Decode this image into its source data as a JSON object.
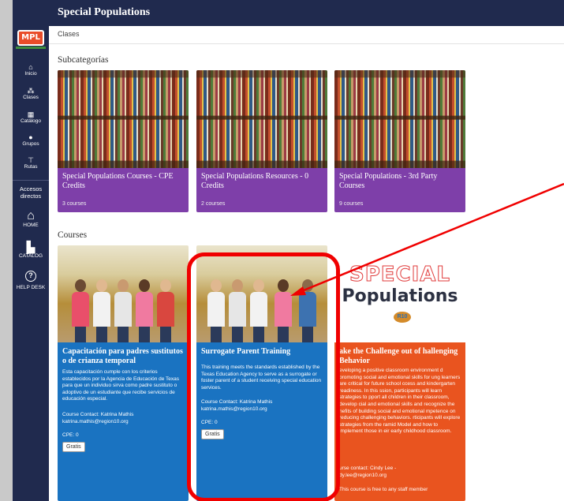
{
  "app": {
    "title": "Special Populations"
  },
  "tabs": {
    "active": "Clases"
  },
  "sidebar": {
    "logo": "MPL",
    "nav": [
      {
        "icon": "home-icon",
        "glyph": "⌂",
        "label": "Inicio"
      },
      {
        "icon": "classes-icon",
        "glyph": "⁂",
        "label": "Clases"
      },
      {
        "icon": "catalog-icon",
        "glyph": "▦",
        "label": "Catálogo"
      },
      {
        "icon": "groups-icon",
        "glyph": "●",
        "label": "Grupos"
      },
      {
        "icon": "routes-icon",
        "glyph": "⊤",
        "label": "Rutas"
      }
    ],
    "shortcuts_title": "Accesos directos",
    "shortcuts": [
      {
        "icon": "home-icon",
        "glyph": "⌂",
        "label": "HOME"
      },
      {
        "icon": "catalog-icon",
        "glyph": "▙",
        "label": "CATALOG"
      },
      {
        "icon": "help-desk-icon",
        "glyph": "?",
        "label": "HELP DESK"
      }
    ]
  },
  "subcategories": {
    "heading": "Subcategorías",
    "items": [
      {
        "title": "Special Populations Courses - CPE Credits",
        "count": "3 courses"
      },
      {
        "title": "Special Populations Resources - 0 Credits",
        "count": "2 courses"
      },
      {
        "title": "Special Populations - 3rd Party Courses",
        "count": "9 courses"
      }
    ]
  },
  "courses": {
    "heading": "Courses",
    "items": [
      {
        "title": "Capacitación para padres sustitutos o de crianza temporal",
        "description": "Esta capacitación cumple con los criterios establecidos por la Agencia de Educación de Texas para que un individuo sirva como padre sustituto o adoptivo de un estudiante que recibe servicios de educación especial.",
        "contact": "Course Contact: Katrina Mathis",
        "email": "katrina.mathis@region10.org",
        "cpe": "CPE: 0",
        "button": "Gratis",
        "color": "#1a73c1"
      },
      {
        "title": "Surrogate Parent Training",
        "description": "This training meets the standards established by the Texas Education Agency to serve as a surrogate or foster parent of a student receiving special education services.",
        "contact": "Course Contact: Katrina Mathis",
        "email": "katrina.mathis@region10.org",
        "cpe": "CPE: 0",
        "button": "Gratis",
        "color": "#1a73c1"
      },
      {
        "title": "ake the Challenge out of hallenging Behavior",
        "description": "eveloping a positive classroom environment d promoting social and emotional skills for ung learners are critical for future school ccess and kindergarten readiness. In this ssion, participants will learn strategies to pport all children in their classroom, develop cial and emotional skills and recognize the nefits of building social and emotional mpetence on reducing challenging behaviors. rticipants will explore strategies from the ramid Model and how to implement those in eir early childhood classroom.",
        "contact": "urse contact: Cindy Lee -",
        "email": "dy.lee@region10.org",
        "note": "This course is free to any staff member",
        "color": "#e9541f",
        "logo_line1": "SPECIAL",
        "logo_line2": "Populations",
        "logo_badge": "R10"
      }
    ]
  },
  "colors": {
    "navy": "#202a4e",
    "purple": "#7e3fa9",
    "blue": "#1a73c1",
    "orange": "#e9541f",
    "annotation": "#f00000"
  }
}
